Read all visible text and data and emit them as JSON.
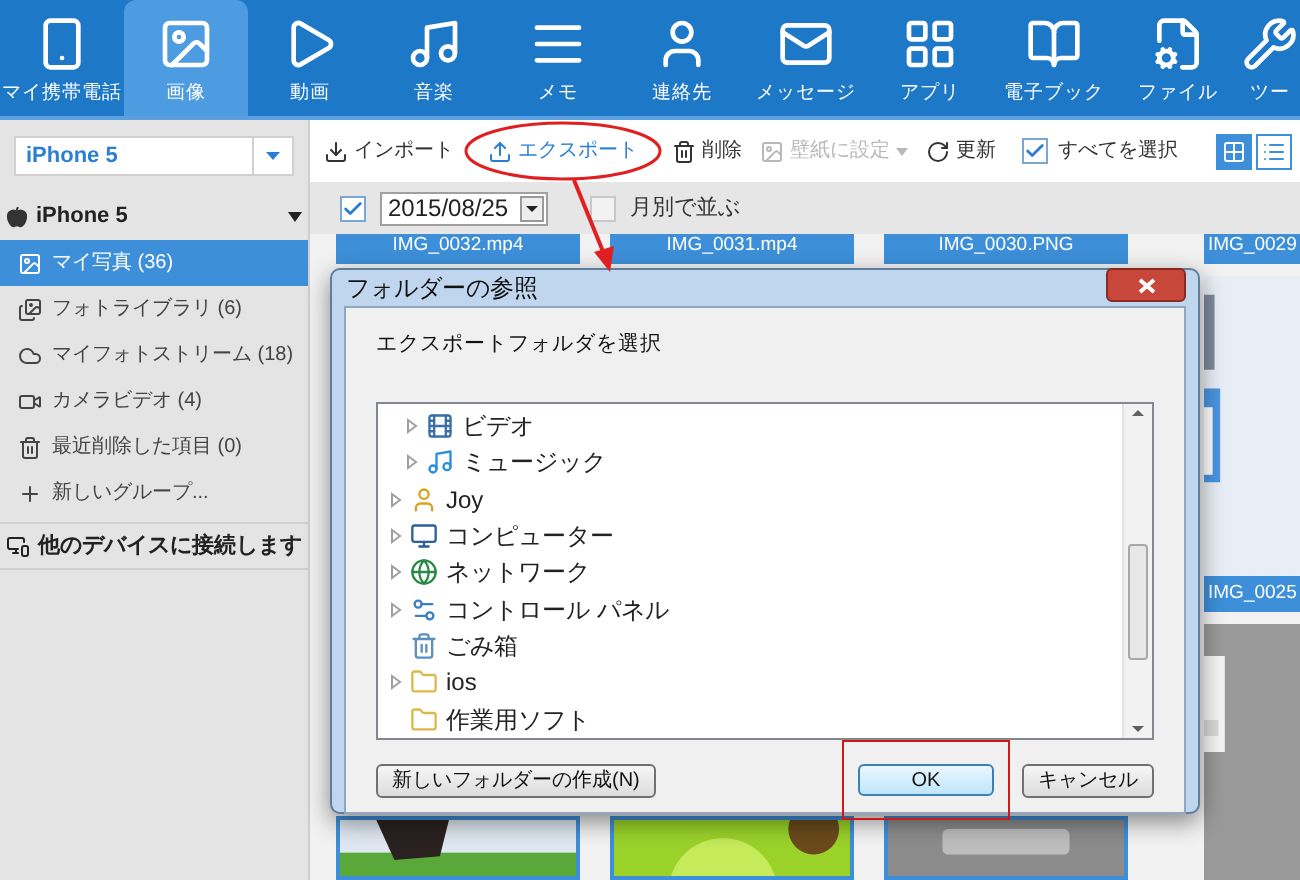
{
  "nav": [
    {
      "label": "マイ携帯電話",
      "selected": false
    },
    {
      "label": "画像",
      "selected": true
    },
    {
      "label": "動画",
      "selected": false
    },
    {
      "label": "音楽",
      "selected": false
    },
    {
      "label": "メモ",
      "selected": false
    },
    {
      "label": "連絡先",
      "selected": false
    },
    {
      "label": "メッセージ",
      "selected": false
    },
    {
      "label": "アプリ",
      "selected": false
    },
    {
      "label": "電子ブック",
      "selected": false
    },
    {
      "label": "ファイル",
      "selected": false
    },
    {
      "label": "ツー",
      "selected": false
    }
  ],
  "sidebar": {
    "device_select": "iPhone 5",
    "device": {
      "name": "iPhone 5",
      "expanded": true
    },
    "items": [
      {
        "label": "マイ写真 (36)",
        "selected": true
      },
      {
        "label": "フォトライブラリ (6)",
        "selected": false
      },
      {
        "label": "マイフォトストリーム (18)",
        "selected": false
      },
      {
        "label": "カメラビデオ (4)",
        "selected": false
      },
      {
        "label": "最近削除した項目 (0)",
        "selected": false
      },
      {
        "label": "新しいグループ...",
        "selected": false
      }
    ],
    "connect": "他のデバイスに接続します"
  },
  "toolbar": {
    "buttons": [
      {
        "label": "インポート",
        "disabled": false
      },
      {
        "label": "エクスポート",
        "disabled": false
      },
      {
        "label": "削除",
        "disabled": false
      },
      {
        "label": "壁紙に設定",
        "disabled": true
      },
      {
        "label": "更新",
        "disabled": false
      }
    ],
    "select_all": {
      "label": "すべてを選択",
      "checked": true
    },
    "views": [
      {
        "selected": true
      },
      {
        "selected": false
      }
    ]
  },
  "filter": {
    "date_checked": true,
    "date": "2015/08/25",
    "by_month": {
      "label": "月別で並ぶ",
      "checked": false
    }
  },
  "gallery": {
    "captions": [
      "IMG_0032.mp4",
      "IMG_0031.mp4",
      "IMG_0030.PNG"
    ],
    "right_captions": [
      "IMG_0029",
      "IMG_0025"
    ]
  },
  "dialog": {
    "title": "フォルダーの参照",
    "prompt": "エクスポートフォルダを選択",
    "tree": [
      {
        "children": [
          {
            "label": "ビデオ",
            "kind": "video",
            "expandable": true
          },
          {
            "label": "ミュージック",
            "kind": "music",
            "expandable": true
          }
        ]
      },
      {
        "label": "Joy",
        "kind": "user",
        "expandable": true
      },
      {
        "label": "コンピューター",
        "kind": "computer",
        "expandable": true
      },
      {
        "label": "ネットワーク",
        "kind": "network",
        "expandable": true
      },
      {
        "label": "コントロール パネル",
        "kind": "control",
        "expandable": true
      },
      {
        "label": "ごみ箱",
        "kind": "trash",
        "expandable": false
      },
      {
        "label": "ios",
        "kind": "folder",
        "expandable": true
      },
      {
        "label": "作業用ソフト",
        "kind": "folder",
        "expandable": false
      }
    ],
    "new_folder": "新しいフォルダーの作成(N)",
    "ok": "OK",
    "cancel": "キャンセル"
  }
}
